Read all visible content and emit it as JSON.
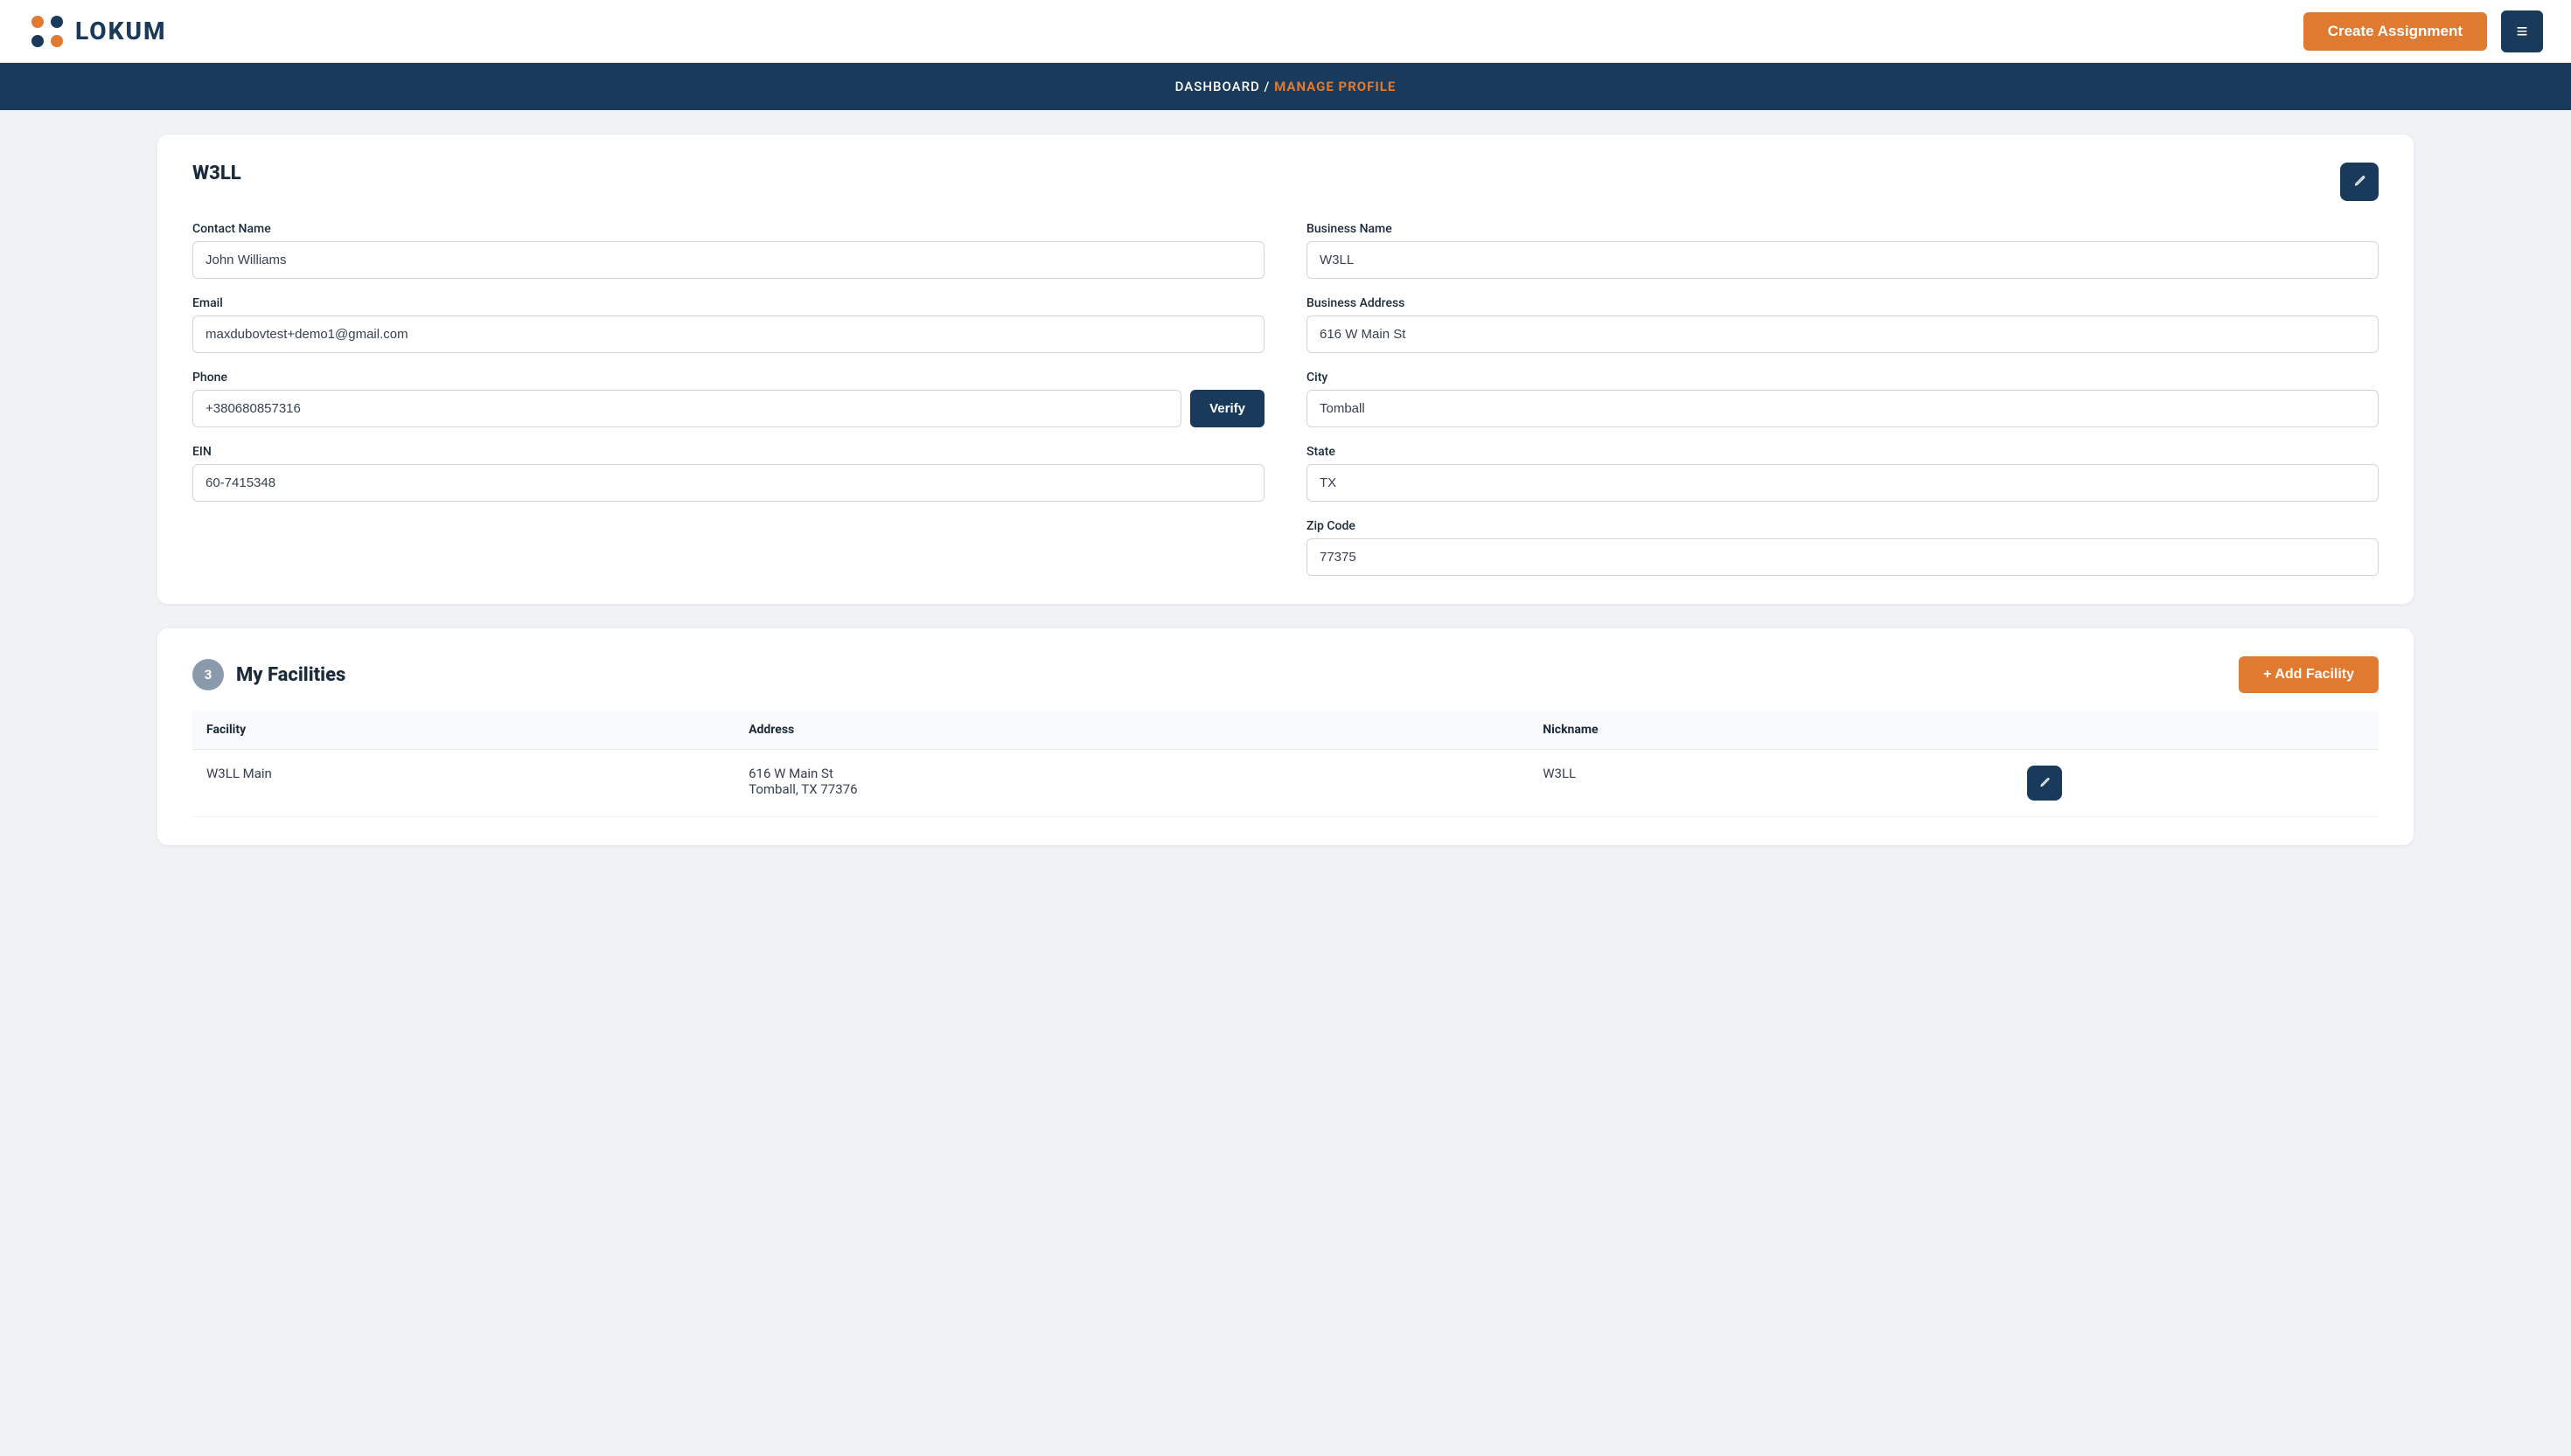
{
  "header": {
    "logo_text": "LOKUM",
    "create_assignment_label": "Create Assignment",
    "menu_icon": "≡"
  },
  "breadcrumb": {
    "dashboard_label": "DASHBOARD",
    "separator": " / ",
    "current_label": "MANAGE PROFILE"
  },
  "profile_card": {
    "section_title": "W3LL",
    "edit_icon": "✎",
    "contact_name_label": "Contact Name",
    "contact_name_value": "John Williams",
    "email_label": "Email",
    "email_value": "maxdubovtest+demo1@gmail.com",
    "phone_label": "Phone",
    "phone_value": "+380680857316",
    "verify_label": "Verify",
    "ein_label": "EIN",
    "ein_value": "60-7415348",
    "business_name_label": "Business Name",
    "business_name_value": "W3LL",
    "business_address_label": "Business Address",
    "business_address_value": "616 W Main St",
    "city_label": "City",
    "city_value": "Tomball",
    "state_label": "State",
    "state_value": "TX",
    "zip_label": "Zip Code",
    "zip_value": "77375"
  },
  "facilities_card": {
    "badge_count": "3",
    "section_title": "My Facilities",
    "add_facility_label": "+ Add Facility",
    "table_headers": [
      "Facility",
      "Address",
      "Nickname"
    ],
    "table_rows": [
      {
        "facility": "W3LL Main",
        "address_line1": "616 W Main St",
        "address_line2": "Tomball, TX 77376",
        "nickname": "W3LL",
        "edit_icon": "✎"
      }
    ]
  }
}
